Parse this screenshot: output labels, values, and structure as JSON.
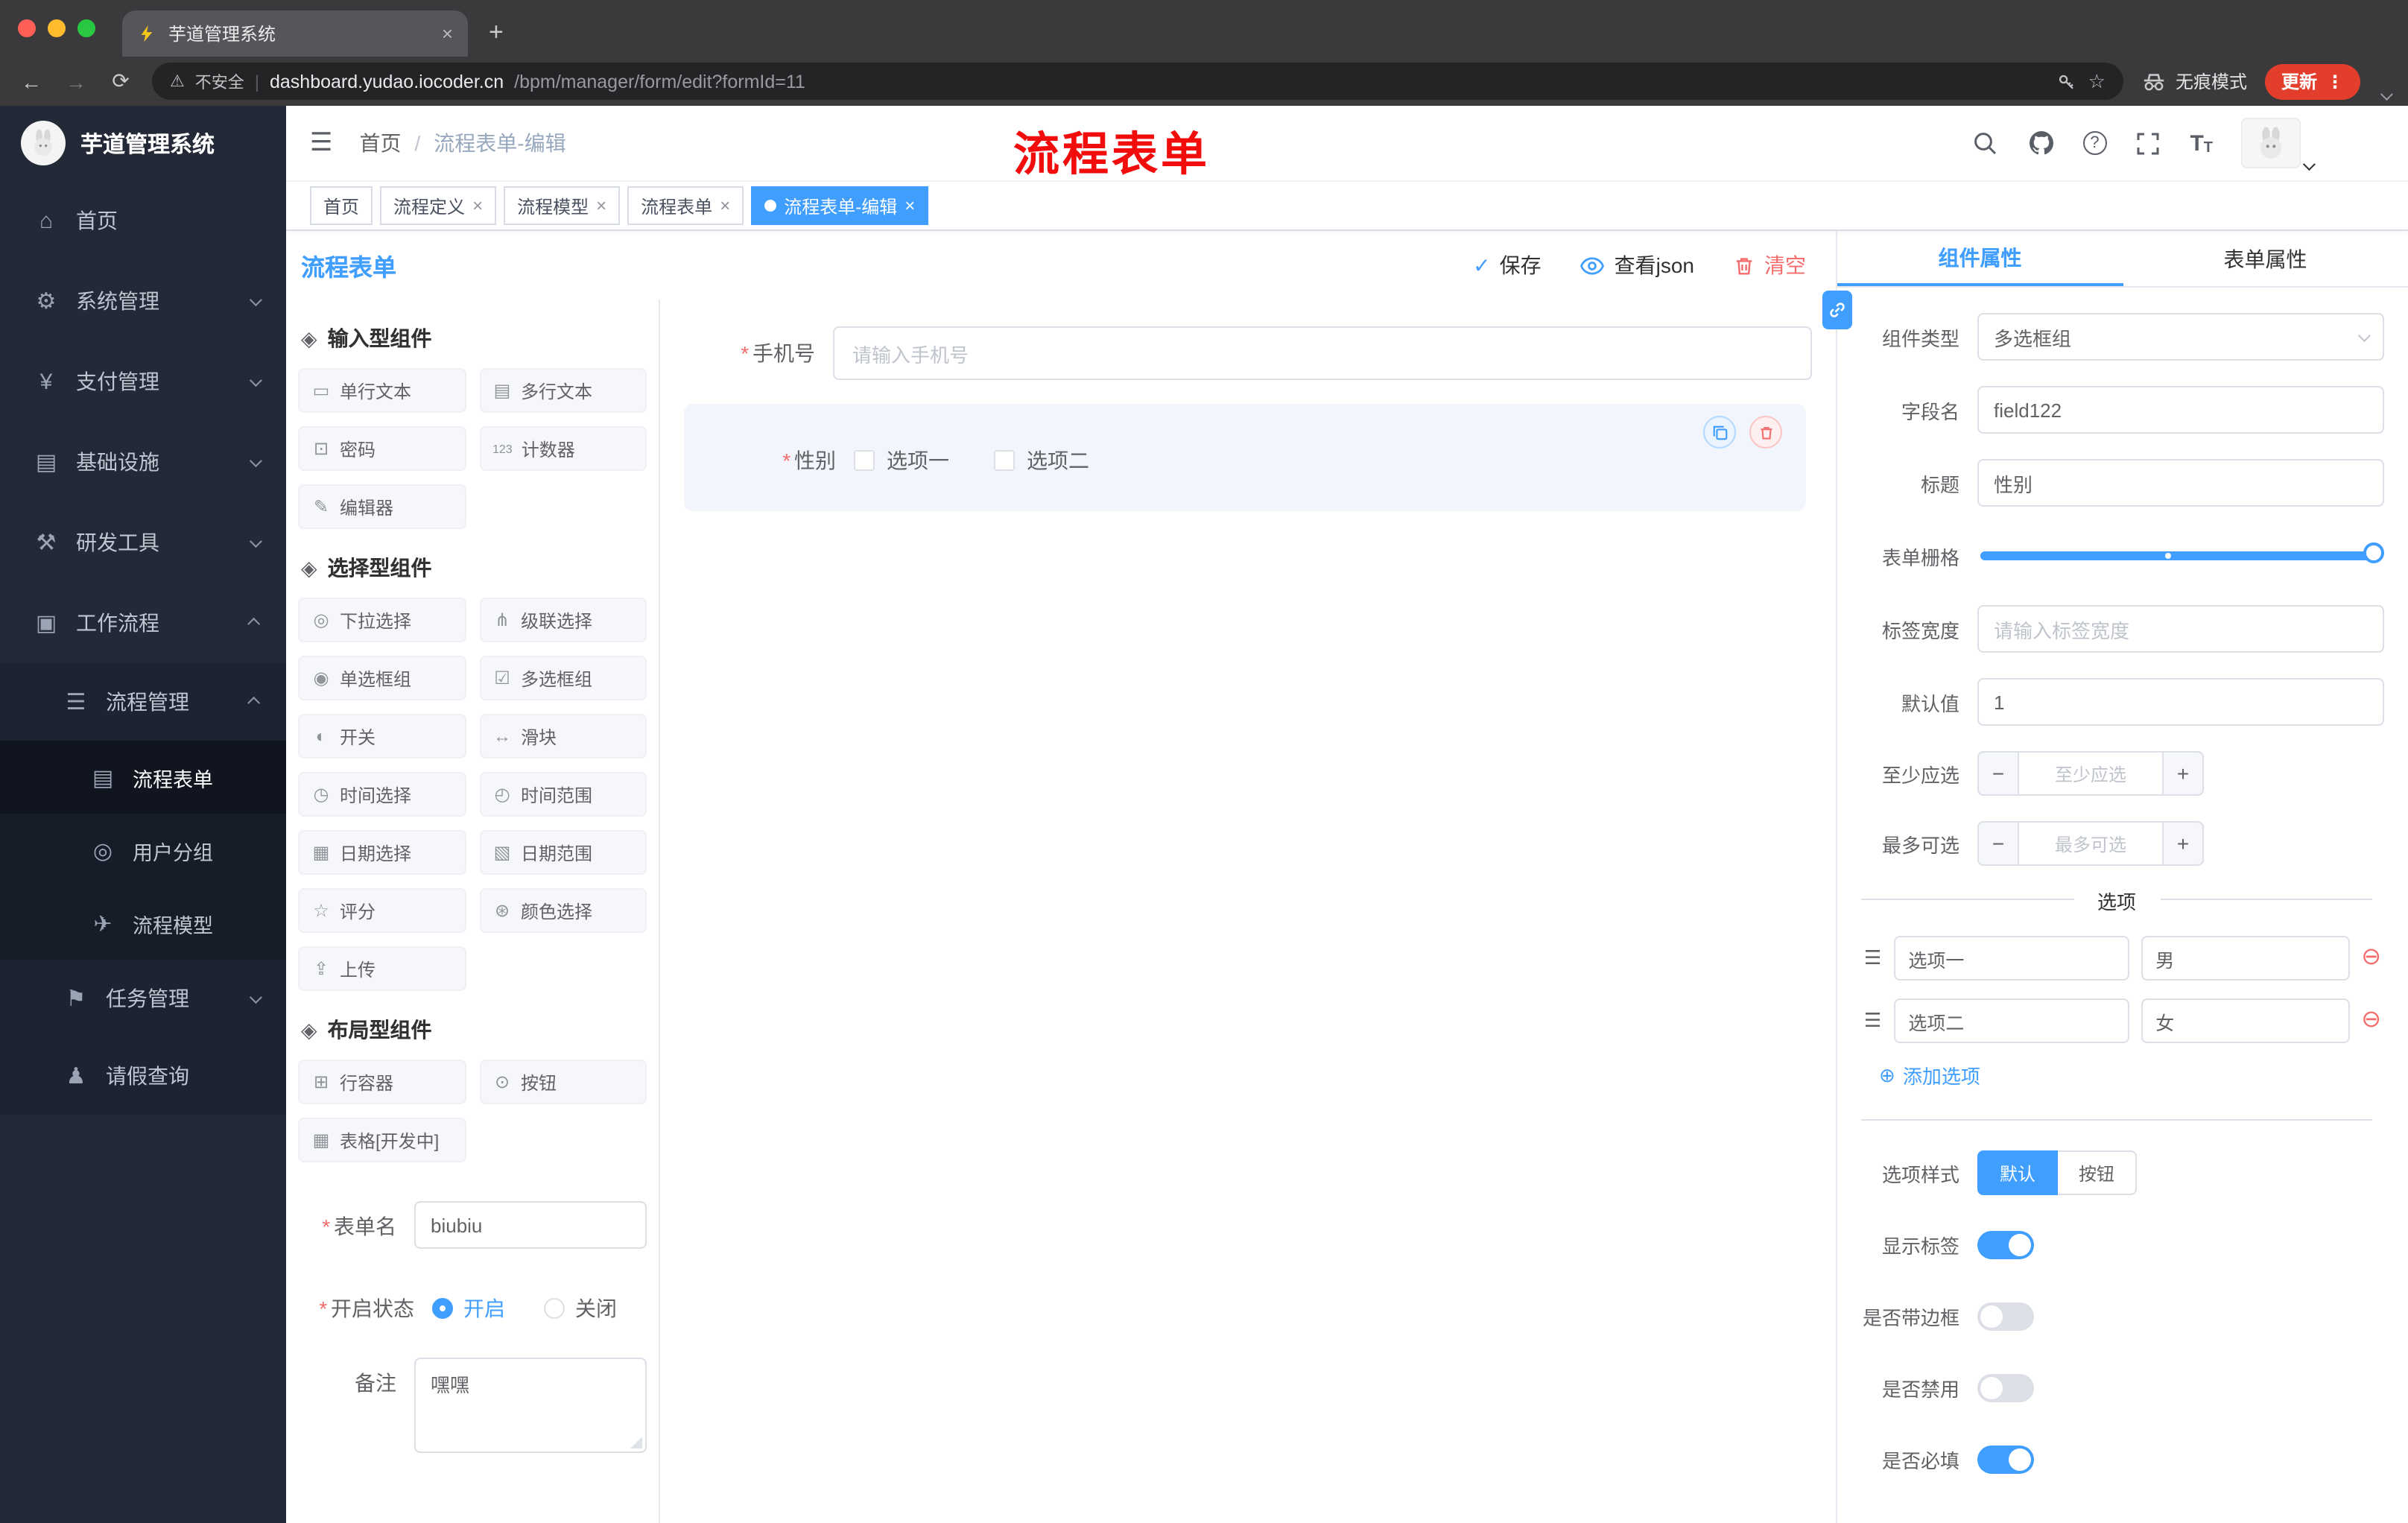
{
  "misc": {
    "asterisk": "*",
    "close": "×",
    "plus": "+",
    "dots": "⋮",
    "hamburger": "☰",
    "slash": "/",
    "pipe": "|",
    "warning": "⚠",
    "back": "←",
    "forward": "→",
    "reload": "⟳",
    "star": "☆",
    "check": "✓",
    "plus_circle": "⊕",
    "minus_circle": "⊖",
    "minus": "−",
    "question": "?",
    "font_icon": "T"
  },
  "colors": {
    "accent": "#409eff",
    "danger": "#f56c6c",
    "annotation": "#f20d0d",
    "sidebar": "#232936",
    "update_pill": "#e23e2b"
  },
  "browser": {
    "tab": {
      "title": "芋道管理系统"
    },
    "address": {
      "warning": "不安全",
      "host": "dashboard.yudao.iocoder.cn",
      "path": "/bpm/manager/form/edit?formId=11"
    },
    "incognito_label": "无痕模式",
    "update_label": "更新"
  },
  "sidebar": {
    "brand": "芋道管理系统",
    "items": [
      {
        "glyph": "⌂",
        "label": "首页"
      },
      {
        "glyph": "⚙",
        "label": "系统管理"
      },
      {
        "glyph": "¥",
        "label": "支付管理"
      },
      {
        "glyph": "▤",
        "label": "基础设施"
      },
      {
        "glyph": "⚒",
        "label": "研发工具"
      },
      {
        "glyph": "▣",
        "label": "工作流程"
      }
    ],
    "sub": {
      "process_mgmt": {
        "glyph": "☰",
        "label": "流程管理"
      },
      "task_mgmt": {
        "glyph": "⚑",
        "label": "任务管理"
      },
      "leave_query": {
        "glyph": "♟",
        "label": "请假查询"
      },
      "children": [
        {
          "glyph": "▤",
          "label": "流程表单"
        },
        {
          "glyph": "◎",
          "label": "用户分组"
        },
        {
          "glyph": "✈",
          "label": "流程模型"
        }
      ]
    }
  },
  "header": {
    "breadcrumb": [
      "首页",
      "流程表单-编辑"
    ],
    "annotation": "流程表单"
  },
  "tags": [
    {
      "label": "首页"
    },
    {
      "label": "流程定义"
    },
    {
      "label": "流程模型"
    },
    {
      "label": "流程表单"
    },
    {
      "label": "流程表单-编辑"
    }
  ],
  "designer": {
    "title": "流程表单",
    "actions": {
      "save": "保存",
      "view_json": "查看json",
      "clear": "清空"
    }
  },
  "palette": {
    "sections": [
      {
        "title": "输入型组件",
        "items": [
          {
            "glyph": "▭",
            "name": "单行文本"
          },
          {
            "glyph": "▤",
            "name": "多行文本"
          },
          {
            "glyph": "⊡",
            "name": "密码"
          },
          {
            "glyph": "123",
            "name": "计数器"
          },
          {
            "glyph": "✎",
            "name": "编辑器"
          }
        ]
      },
      {
        "title": "选择型组件",
        "items": [
          {
            "glyph": "◎",
            "name": "下拉选择"
          },
          {
            "glyph": "⋔",
            "name": "级联选择"
          },
          {
            "glyph": "◉",
            "name": "单选框组"
          },
          {
            "glyph": "☑",
            "name": "多选框组"
          },
          {
            "glyph": "◐",
            "name": "开关"
          },
          {
            "glyph": "↔",
            "name": "滑块"
          },
          {
            "glyph": "◷",
            "name": "时间选择"
          },
          {
            "glyph": "◴",
            "name": "时间范围"
          },
          {
            "glyph": "▦",
            "name": "日期选择"
          },
          {
            "glyph": "▧",
            "name": "日期范围"
          },
          {
            "glyph": "☆",
            "name": "评分"
          },
          {
            "glyph": "⊛",
            "name": "颜色选择"
          },
          {
            "glyph": "⇪",
            "name": "上传"
          }
        ]
      },
      {
        "title": "布局型组件",
        "items": [
          {
            "glyph": "⊞",
            "name": "行容器"
          },
          {
            "glyph": "⊙",
            "name": "按钮"
          },
          {
            "glyph": "▦",
            "name": "表格[开发中]"
          }
        ]
      }
    ]
  },
  "form_meta": {
    "name_label": "表单名",
    "name_value": "biubiu",
    "status_label": "开启状态",
    "status_on": "开启",
    "status_off": "关闭",
    "remark_label": "备注",
    "remark_value": "嘿嘿"
  },
  "canvas": {
    "phone": {
      "label": "手机号",
      "placeholder": "请输入手机号"
    },
    "gender": {
      "label": "性别",
      "options": [
        "选项一",
        "选项二"
      ]
    }
  },
  "props": {
    "tabs": [
      "组件属性",
      "表单属性"
    ],
    "component_type_label": "组件类型",
    "component_type_value": "多选框组",
    "field_name_label": "字段名",
    "field_name_value": "field122",
    "title_label": "标题",
    "title_value": "性别",
    "grid_label": "表单栅格",
    "label_width_label": "标签宽度",
    "label_width_placeholder": "请输入标签宽度",
    "default_label": "默认值",
    "default_value": "1",
    "min_label": "至少应选",
    "min_placeholder": "至少应选",
    "max_label": "最多可选",
    "max_placeholder": "最多可选",
    "options_title": "选项",
    "options": [
      {
        "label": "选项一",
        "value": "男"
      },
      {
        "label": "选项二",
        "value": "女"
      }
    ],
    "add_option": "添加选项",
    "style_label": "选项样式",
    "style_default": "默认",
    "style_button": "按钮",
    "show_label": "显示标签",
    "border_label": "是否带边框",
    "disabled_label": "是否禁用",
    "required_label": "是否必填"
  }
}
